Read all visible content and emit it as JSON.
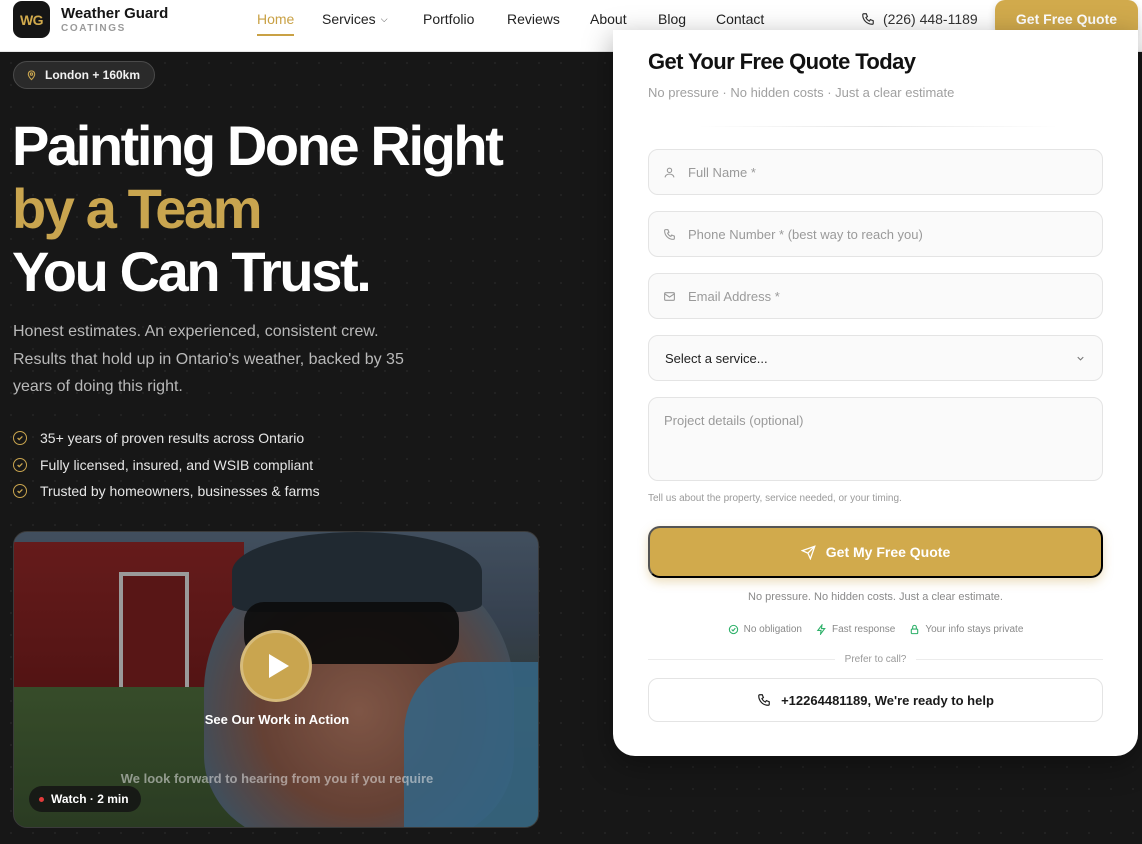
{
  "brand": {
    "mark": "WG",
    "name": "Weather Guard",
    "tagline": "COATINGS"
  },
  "nav": {
    "links": [
      {
        "label": "Home",
        "active": true
      },
      {
        "label": "Services",
        "has_dropdown": true
      },
      {
        "label": "Portfolio"
      },
      {
        "label": "Reviews"
      },
      {
        "label": "About"
      },
      {
        "label": "Blog"
      },
      {
        "label": "Contact"
      }
    ],
    "phone": "(226) 448-1189",
    "cta": "Get Free Quote"
  },
  "hero": {
    "location": "London + 160km",
    "headline_line1": "Painting Done Right",
    "headline_line2": "by a Team",
    "headline_line3": "You Can Trust.",
    "lead": "Honest estimates. An experienced, consistent crew. Results that hold up in Ontario's weather, backed by 35 years of doing this right.",
    "bullets": [
      "35+ years of proven results across Ontario",
      "Fully licensed, insured, and WSIB compliant",
      "Trusted by homeowners, businesses & farms"
    ],
    "video": {
      "caption": "See Our Work in Action",
      "subtitle": "We look forward to hearing from you if you require",
      "duration": "Watch · 2 min"
    }
  },
  "form": {
    "title": "Get Your Free Quote Today",
    "subtitle": "No pressure · No hidden costs · Just a clear estimate",
    "full_name_placeholder": "Full Name *",
    "phone_placeholder": "Phone Number * (best way to reach you)",
    "email_placeholder": "Email Address *",
    "service_select": "Select a service...",
    "details_placeholder": "Project details (optional)",
    "hint": "Tell us about the property, service needed, or your timing.",
    "submit": "Get My Free Quote",
    "note": "No pressure. No hidden costs. Just a clear estimate.",
    "badges": [
      "No obligation",
      "Fast response",
      "Your info stays private"
    ],
    "call_prompt": "Prefer to call?",
    "call_button": "+12264481189, We're ready to help"
  },
  "colors": {
    "accent": "#d1aa4c",
    "dark": "#171717",
    "card": "#ffffff"
  }
}
